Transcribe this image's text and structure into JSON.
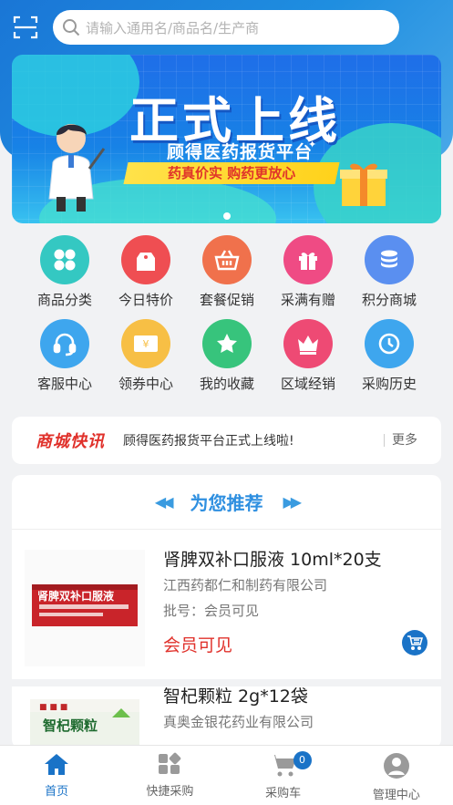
{
  "search": {
    "placeholder": "请输入通用名/商品名/生产商"
  },
  "banner": {
    "title": "正式上线",
    "subtitle": "顾得医药报货平台",
    "slogan": "药真价实  购药更放心"
  },
  "nav": [
    {
      "label": "商品分类",
      "icon": "grid-icon",
      "color": "#34c8c2"
    },
    {
      "label": "今日特价",
      "icon": "price-tag-icon",
      "color": "#ef4e52"
    },
    {
      "label": "套餐促销",
      "icon": "basket-icon",
      "color": "#f0714c"
    },
    {
      "label": "采满有赠",
      "icon": "gift-icon",
      "color": "#ef4b84"
    },
    {
      "label": "积分商城",
      "icon": "coins-icon",
      "color": "#5a8ff0"
    },
    {
      "label": "客服中心",
      "icon": "headset-icon",
      "color": "#3ea6ee"
    },
    {
      "label": "领券中心",
      "icon": "coupon-icon",
      "color": "#f7bf45"
    },
    {
      "label": "我的收藏",
      "icon": "star-icon",
      "color": "#37c47c"
    },
    {
      "label": "区域经销",
      "icon": "crown-icon",
      "color": "#ee4a74"
    },
    {
      "label": "采购历史",
      "icon": "clock-icon",
      "color": "#3ea6ee"
    }
  ],
  "news": {
    "brand": "商城快讯",
    "text": "顾得医药报货平台正式上线啦!",
    "more": "更多"
  },
  "recommend": {
    "title": "为您推荐",
    "products": [
      {
        "name": "肾脾双补口服液 10ml*20支",
        "company": "江西药都仁和制药有限公司",
        "batch": "批号：会员可见",
        "price": "会员可见",
        "box_text": "肾脾双补口服液"
      },
      {
        "name": "智杞颗粒 2g*12袋",
        "company": "真奥金银花药业有限公司",
        "box_text": "智杞颗粒"
      }
    ]
  },
  "tabbar": {
    "cart_count": "0",
    "tabs": [
      {
        "label": "首页",
        "icon": "home-icon"
      },
      {
        "label": "快捷采购",
        "icon": "quick-purchase-icon"
      },
      {
        "label": "采购车",
        "icon": "cart-icon"
      },
      {
        "label": "管理中心",
        "icon": "user-icon"
      }
    ]
  }
}
